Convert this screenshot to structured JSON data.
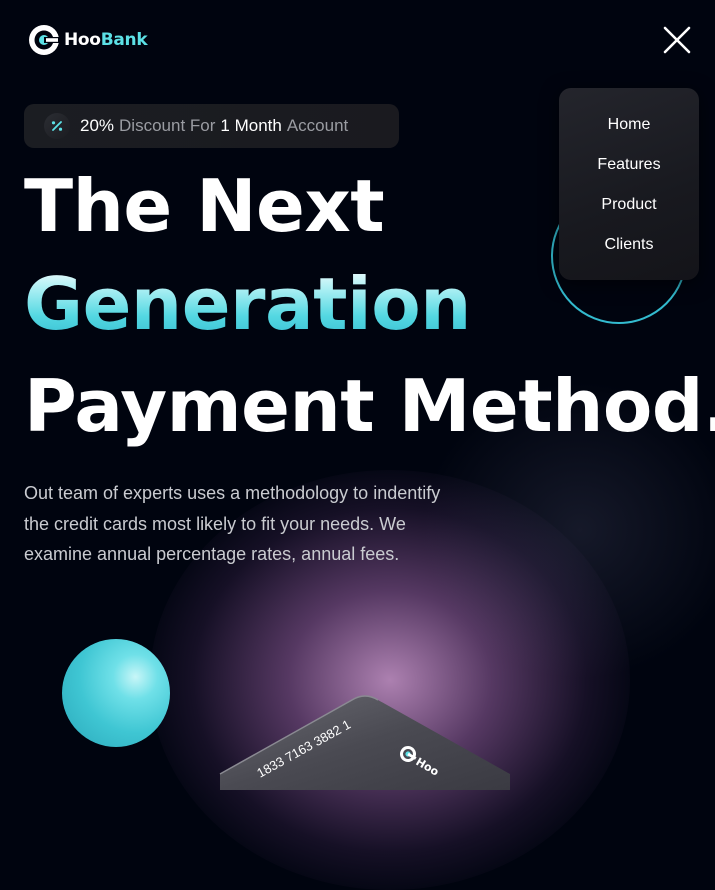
{
  "brand": {
    "name_part1": "Hoo",
    "name_part2": "Bank",
    "accent": "#5ce1e6",
    "accent_dark": "#33bbcf",
    "background": "#00040f"
  },
  "nav": {
    "close_icon": "close-icon",
    "menu": [
      {
        "label": "Home"
      },
      {
        "label": "Features"
      },
      {
        "label": "Product"
      },
      {
        "label": "Clients"
      }
    ]
  },
  "promo": {
    "icon": "discount-icon",
    "percent": "20%",
    "text1": "Discount For",
    "duration": "1 Month",
    "text2": "Account"
  },
  "hero": {
    "line1": "The Next",
    "line2": "Generation",
    "line3": "Payment Method.",
    "description": "Out team of experts uses a methodology to indentify the credit cards most likely to fit your needs. We examine annual percentage rates, annual fees."
  },
  "card": {
    "number": "1833 7163 3882 1"
  }
}
